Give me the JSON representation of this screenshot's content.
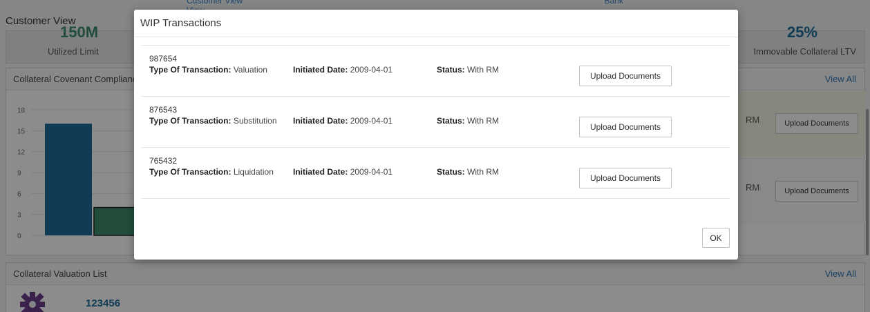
{
  "background": {
    "tabs": [
      "Customer View",
      "Bank View"
    ],
    "page_title": "Customer View",
    "kpi_left": {
      "value": "150M",
      "label": "Utilized Limit"
    },
    "kpi_right": {
      "value": "25%",
      "label": "Immovable Collateral LTV"
    },
    "covenant_panel": {
      "title": "Collateral Covenant Compliance",
      "view_all": "View All",
      "rows": [
        {
          "status_fragment": "RM",
          "button": "Upload Documents"
        },
        {
          "status_fragment": "RM",
          "button": "Upload Documents"
        }
      ]
    },
    "chart_data": {
      "type": "bar",
      "yticks": [
        "18",
        "15",
        "12",
        "9",
        "6",
        "3",
        "0"
      ],
      "ylim": [
        0,
        18
      ],
      "categories": [
        "",
        ""
      ],
      "values": [
        16,
        4
      ],
      "colors": [
        "#1d6c9a",
        "#3c8c6a"
      ]
    },
    "valuation_panel": {
      "title": "Collateral Valuation List",
      "view_all": "View All",
      "item_id": "123456"
    }
  },
  "modal": {
    "title": "WIP Transactions",
    "labels": {
      "type": "Type Of Transaction:",
      "date": "Initiated Date:",
      "status": "Status:"
    },
    "transactions": [
      {
        "id": "987654",
        "type": "Valuation",
        "date": "2009-04-01",
        "status": "With RM",
        "button": "Upload Documents"
      },
      {
        "id": "876543",
        "type": "Substitution",
        "date": "2009-04-01",
        "status": "With RM",
        "button": "Upload Documents"
      },
      {
        "id": "765432",
        "type": "Liquidation",
        "date": "2009-04-01",
        "status": "With RM",
        "button": "Upload Documents"
      }
    ],
    "ok_label": "OK"
  }
}
